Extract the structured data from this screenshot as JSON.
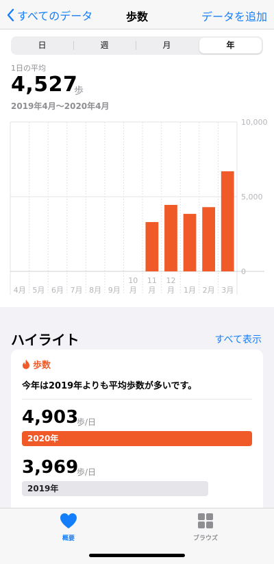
{
  "nav": {
    "back_label": "すべてのデータ",
    "title": "歩数",
    "add_label": "データを追加"
  },
  "segments": [
    {
      "label": "日",
      "active": false
    },
    {
      "label": "週",
      "active": false
    },
    {
      "label": "月",
      "active": false
    },
    {
      "label": "年",
      "active": true
    }
  ],
  "summary": {
    "avg_label": "1日の平均",
    "avg_value": "4,527",
    "avg_unit": "歩",
    "range": "2019年4月〜2020年4月"
  },
  "chart_data": {
    "type": "bar",
    "categories": [
      "4月",
      "5月",
      "6月",
      "7月",
      "8月",
      "9月",
      "10月",
      "11月",
      "12月",
      "1月",
      "2月",
      "3月"
    ],
    "category_labels": [
      [
        "4月"
      ],
      [
        "5月"
      ],
      [
        "6月"
      ],
      [
        "7月"
      ],
      [
        "8月"
      ],
      [
        "9月"
      ],
      [
        "10",
        "月"
      ],
      [
        "11",
        "月"
      ],
      [
        "12",
        "月"
      ],
      [
        "1月"
      ],
      [
        "2月"
      ],
      [
        "3月"
      ]
    ],
    "values": [
      null,
      null,
      null,
      null,
      null,
      null,
      null,
      3300,
      4450,
      3850,
      4300,
      6700
    ],
    "yticks": [
      "10,000",
      "5,000",
      "0"
    ],
    "ylim": [
      0,
      10000
    ],
    "grid": true,
    "bar_color": "#f05a28"
  },
  "highlights": {
    "heading": "ハイライト",
    "show_all": "すべて表示",
    "card": {
      "tag": "歩数",
      "text": "今年は2019年よりも平均歩数が多いです。",
      "stats": [
        {
          "value": "4,903",
          "unit": "歩/日",
          "bar_label": "2020年",
          "fraction": 1.0
        },
        {
          "value": "3,969",
          "unit": "歩/日",
          "bar_label": "2019年",
          "fraction": 0.81
        }
      ]
    }
  },
  "tabbar": {
    "summary_label": "概要",
    "browse_label": "ブラウズ"
  },
  "colors": {
    "accent": "#147efb",
    "steps": "#f05a28"
  }
}
